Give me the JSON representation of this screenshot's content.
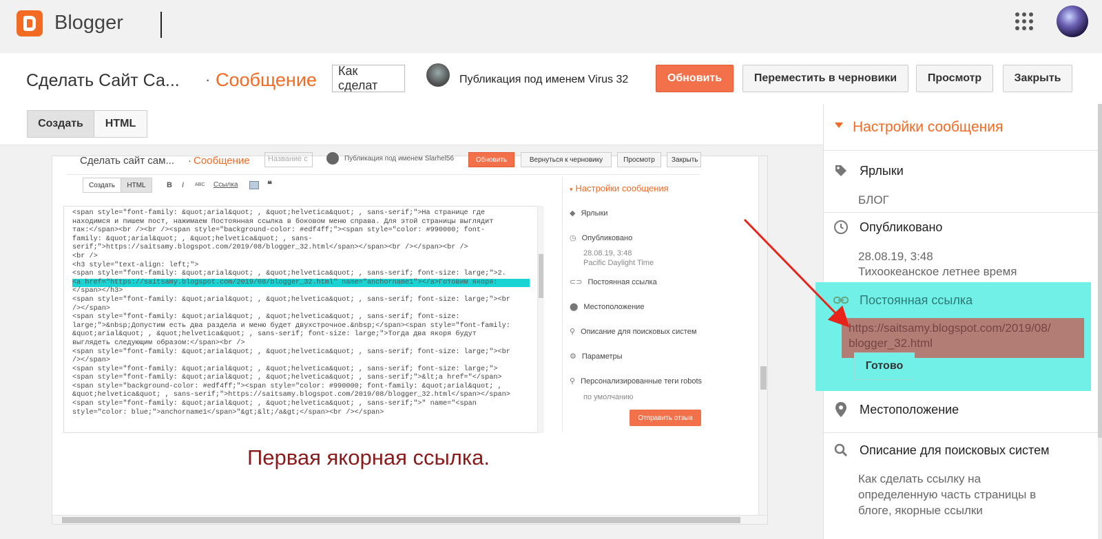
{
  "topbar": {
    "brand": "Blogger"
  },
  "header": {
    "blog_title": "Сделать Сайт Са...",
    "separator": "·",
    "section": "Сообщение",
    "title_input_value": "Как сделат",
    "publishing_as": "Публикация под именем",
    "author": "Virus 32",
    "update_label": "Обновить",
    "revert_label": "Переместить в черновики",
    "preview_label": "Просмотр",
    "close_label": "Закрыть"
  },
  "editor": {
    "tab_compose": "Создать",
    "tab_html": "HTML"
  },
  "embedded_shot": {
    "blog_title": "Сделать сайт сам...",
    "separator": "·",
    "section": "Сообщение",
    "title_placeholder": "Название с",
    "publishing_as": "Публикация под именем Slarhel56",
    "update_label": "Обновить",
    "revert_label": "Вернуться к черновику",
    "preview_label": "Просмотр",
    "close_label": "Закрыть",
    "tab_compose": "Создать",
    "tab_html": "HTML",
    "tool_bold": "B",
    "tool_italic": "I",
    "tool_strike": "ABC",
    "tool_link": "Ссылка",
    "tool_quote": "❝",
    "code_lines": [
      "<span style=\"font-family: &quot;arial&quot; , &quot;helvetica&quot; , sans-serif;\">На странице где",
      "находимся и пишем пост, нажимаем Постоянная ссылка в боковом меню справа. Для этой страницы выглядит",
      "так:</span><br /><br /><span style=\"background-color: #edf4ff;\"><span style=\"color: #990000; font-",
      "family: &quot;arial&quot; , &quot;helvetica&quot; , sans-",
      "serif;\">https://saitsamy.blogspot.com/2019/08/blogger_32.html</span></span><br /></span><br />",
      "<br />",
      "<h3 style=\"text-align: left;\">",
      "<span style=\"font-family: &quot;arial&quot; , &quot;helvetica&quot; , sans-serif; font-size: large;\">2.",
      "<a href=\"https://saitsamy.blogspot.com/2019/08/blogger_32.html\" name=\"anchorname1\"></a>Готовим якоря:",
      "</span></h3>",
      "<span style=\"font-family: &quot;arial&quot; , &quot;helvetica&quot; , sans-serif; font-size: large;\"><br",
      "/></span>",
      "<span style=\"font-family: &quot;arial&quot; , &quot;helvetica&quot; , sans-serif; font-size:",
      "large;\">&nbsp;Допустим есть два раздела и меню будет двухстрочное.&nbsp;</span><span style=\"font-family:",
      "&quot;arial&quot; , &quot;helvetica&quot; , sans-serif; font-size: large;\">Тогда два якоря будут",
      "выглядеть следующим образом:</span><br />",
      "<span style=\"font-family: &quot;arial&quot; , &quot;helvetica&quot; , sans-serif; font-size: large;\"><br",
      "/></span>",
      "<span style=\"font-family: &quot;arial&quot; , &quot;helvetica&quot; , sans-serif; font-size: large;\">",
      "<span style=\"font-family: &quot;arial&quot; , &quot;helvetica&quot; , sans-serif;\">&lt;a href=\"</span>",
      "<span style=\"background-color: #edf4ff;\"><span style=\"color: #990000; font-family: &quot;arial&quot; ,",
      "&quot;helvetica&quot; , sans-serif;\">https://saitsamy.blogspot.com/2019/08/blogger_32.html</span></span>",
      "<span style=\"font-family: &quot;arial&quot; , &quot;helvetica&quot; , sans-serif;\">\" name=\"<span",
      "style=\"color: blue;\">anchorname1</span>\"&gt;&lt;/a&gt;</span><br /></span>"
    ],
    "side_title": "Настройки сообщения",
    "side_labels": "Ярлыки",
    "side_published": "Опубликовано",
    "side_published_date": "28.08.19, 3:48",
    "side_published_tz": "Pacific Daylight Time",
    "side_permalink": "Постоянная ссылка",
    "side_location": "Местоположение",
    "side_search": "Описание для поисковых систем",
    "side_options": "Параметры",
    "side_robots": "Персонализированные теги robots",
    "side_robots_val": "по умолчанию",
    "feedback_label": "Отправить отзыв"
  },
  "caption": "Первая якорная ссылка.",
  "sidebar": {
    "title": "Настройки сообщения",
    "labels_title": "Ярлыки",
    "labels_value": "БЛОГ",
    "published_title": "Опубликовано",
    "published_date": "28.08.19, 3:48",
    "published_tz": "Тихоокеанское летнее время",
    "permalink_title": "Постоянная ссылка",
    "permalink_line1": "https://saitsamy.blogspot.com/2019/08/",
    "permalink_line2": "blogger_32.html",
    "done_label": "Готово",
    "location_title": "Местоположение",
    "search_title": "Описание для поисковых систем",
    "search_line1": "Как сделать ссылку на",
    "search_line2": "определенную часть страницы в",
    "search_line3": "блоге, якорные ссылки"
  },
  "colors": {
    "accent": "#f36a23",
    "highlight": "#71f0e8",
    "url_box": "#b27d74",
    "caption": "#8b1a1a",
    "arrow": "#e8231a"
  }
}
